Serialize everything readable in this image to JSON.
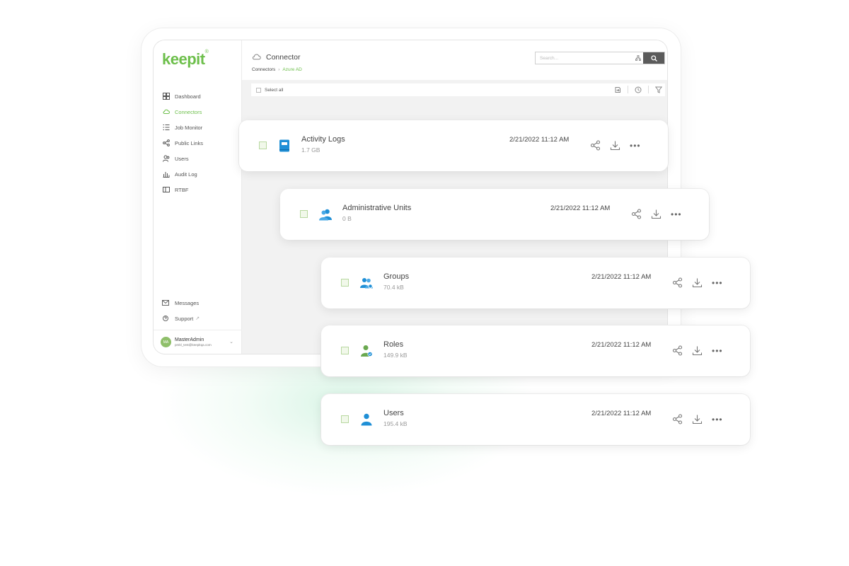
{
  "app": {
    "logo": "keepit",
    "logo_mark": "®"
  },
  "sidebar": {
    "items": [
      {
        "label": "Dashboard",
        "icon": "dashboard-icon"
      },
      {
        "label": "Connectors",
        "icon": "cloud-icon",
        "active": true
      },
      {
        "label": "Job Monitor",
        "icon": "list-icon"
      },
      {
        "label": "Public Links",
        "icon": "share-icon"
      },
      {
        "label": "Users",
        "icon": "users-icon"
      },
      {
        "label": "Audit Log",
        "icon": "audit-icon"
      },
      {
        "label": "RTBF",
        "icon": "id-card-icon"
      }
    ],
    "bottom": [
      {
        "label": "Messages",
        "icon": "mail-icon"
      },
      {
        "label": "Support",
        "icon": "support-icon"
      }
    ],
    "user": {
      "initials": "MA",
      "name": "MasterAdmin",
      "email": "pmkl_test@keepitqa.com"
    }
  },
  "header": {
    "title": "Connector",
    "breadcrumb": [
      "Connectors",
      "Azure AD"
    ],
    "search_placeholder": "Search..."
  },
  "toolbar": {
    "select_all": "Select all"
  },
  "colors": {
    "accent": "#6dbf4b",
    "icon_blue": "#1f8fd6",
    "icon_green": "#6aa84f"
  },
  "items": [
    {
      "name": "Activity Logs",
      "size": "1.7 GB",
      "date": "2/21/2022 11:12 AM",
      "icon": "book-icon"
    },
    {
      "name": "Administrative Units",
      "size": "0 B",
      "date": "2/21/2022 11:12 AM",
      "icon": "group-icon"
    },
    {
      "name": "Groups",
      "size": "70.4 kB",
      "date": "2/21/2022 11:12 AM",
      "icon": "groups-icon"
    },
    {
      "name": "Roles",
      "size": "149.9 kB",
      "date": "2/21/2022 11:12 AM",
      "icon": "role-icon"
    },
    {
      "name": "Users",
      "size": "195.4 kB",
      "date": "2/21/2022 11:12 AM",
      "icon": "user-icon"
    }
  ]
}
